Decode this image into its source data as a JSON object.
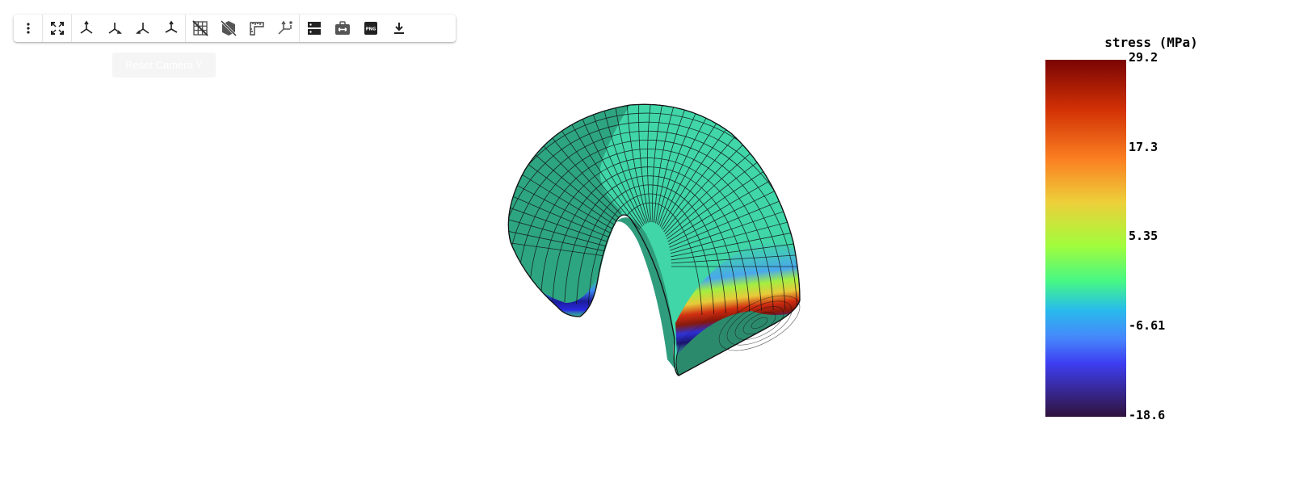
{
  "toolbar": {
    "buttons": [
      {
        "name": "menu-button",
        "icon": "more-vertical-icon"
      },
      {
        "name": "fullscreen-button",
        "icon": "fullscreen-icon"
      },
      {
        "name": "view-xy-button",
        "icon": "axes-xy-icon"
      },
      {
        "name": "view-xz-button",
        "icon": "axes-xz-icon"
      },
      {
        "name": "view-yz-button",
        "icon": "axes-yz-icon"
      },
      {
        "name": "view-isometric-button",
        "icon": "axes-iso-icon"
      },
      {
        "name": "toggle-grid-button",
        "icon": "grid-off-icon"
      },
      {
        "name": "toggle-parallel-button",
        "icon": "cube-off-icon"
      },
      {
        "name": "ruler-button",
        "icon": "ruler-icon"
      },
      {
        "name": "axes-info-button",
        "icon": "axes-info-icon"
      },
      {
        "name": "server-button",
        "icon": "server-icon"
      },
      {
        "name": "pan-button",
        "icon": "briefcase-arrows-icon"
      },
      {
        "name": "screenshot-png-button",
        "icon": "png-icon"
      },
      {
        "name": "download-button",
        "icon": "download-icon"
      }
    ],
    "tooltip": "Reset Camera Y"
  },
  "colorbar": {
    "title": "stress (MPa)",
    "labels": [
      "29.2",
      "17.3",
      "5.35",
      "-6.61",
      "-18.6"
    ],
    "max": 29.2,
    "min": -18.6,
    "colormap": "turbo"
  },
  "colors": {
    "mesh_base": "#3fd3a6",
    "mesh_lines": "#1a1a1a",
    "background": "#ffffff"
  }
}
